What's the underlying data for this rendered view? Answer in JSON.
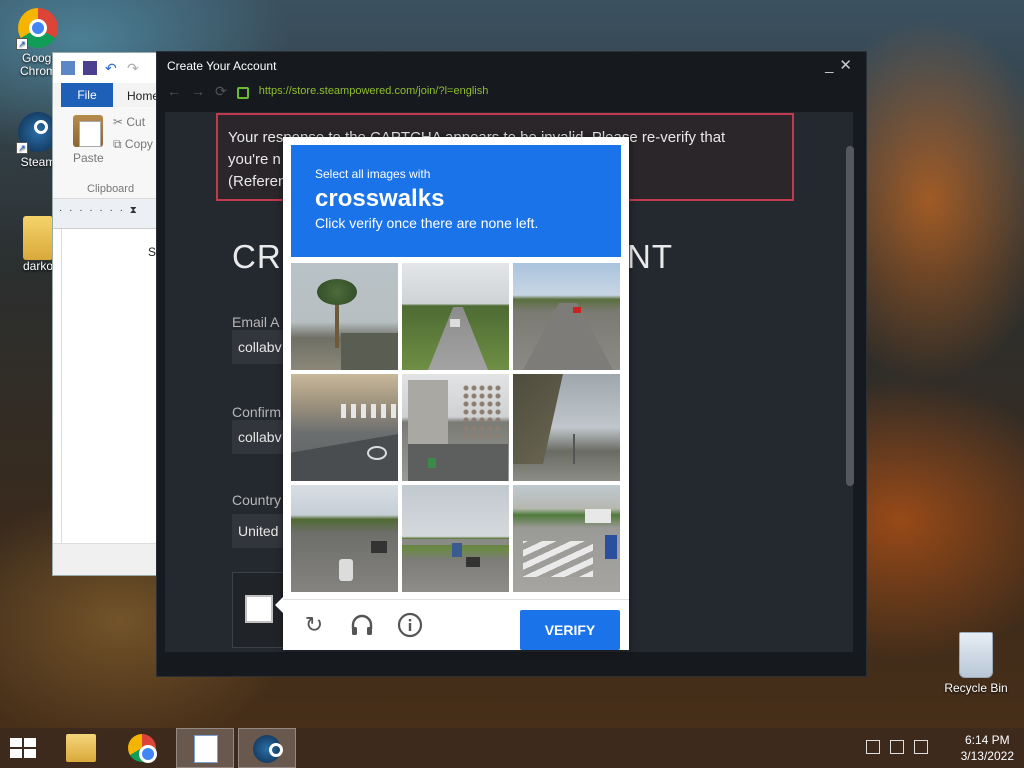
{
  "desktop": {
    "icons": [
      {
        "label_line1": "Googl",
        "label_line2": "Chrom",
        "icon": "chrome-icon"
      },
      {
        "label_line1": "Steam",
        "icon": "steam-icon"
      },
      {
        "label_line1": "darko",
        "icon": "folder-icon"
      },
      {
        "label_line1": "Recycle Bin",
        "icon": "recycle-bin-icon"
      }
    ]
  },
  "wordpad": {
    "tab_file": "File",
    "tab_home": "Home",
    "paste": "Paste",
    "cut": "Cut",
    "copy": "Copy",
    "clipboard": "Clipboard",
    "doc_text": "S"
  },
  "steam_window": {
    "title": "Create Your Account",
    "url": "https://store.steampowered.com/join/?l=english",
    "error_line1": "Your response to the CAPTCHA appears to be invalid. Please re-verify that",
    "error_line2": "you're n",
    "error_line3": "(Referen",
    "heading_start": "CR",
    "heading_end": "NT",
    "email_label": "Email A",
    "email_value": "collabv",
    "confirm_label": "Confirm",
    "confirm_value": "collabv",
    "country_label": "Country",
    "country_value": "United"
  },
  "captcha": {
    "instruction": "Select all images with",
    "target": "crosswalks",
    "hint": "Click verify once there are none left.",
    "verify_label": "VERIFY",
    "tiles": [
      "palm-tree",
      "road-median",
      "road-traffic",
      "intersection-crosswalk",
      "parking-garage",
      "street-buildings",
      "motorcycle-road",
      "highway-overpass",
      "crosswalk-street"
    ]
  },
  "taskbar": {
    "time": "6:14 PM",
    "date": "3/13/2022"
  },
  "colors": {
    "captcha_blue": "#1a73e8",
    "error_border": "#c0394c",
    "url_green": "#8fbe2e"
  }
}
